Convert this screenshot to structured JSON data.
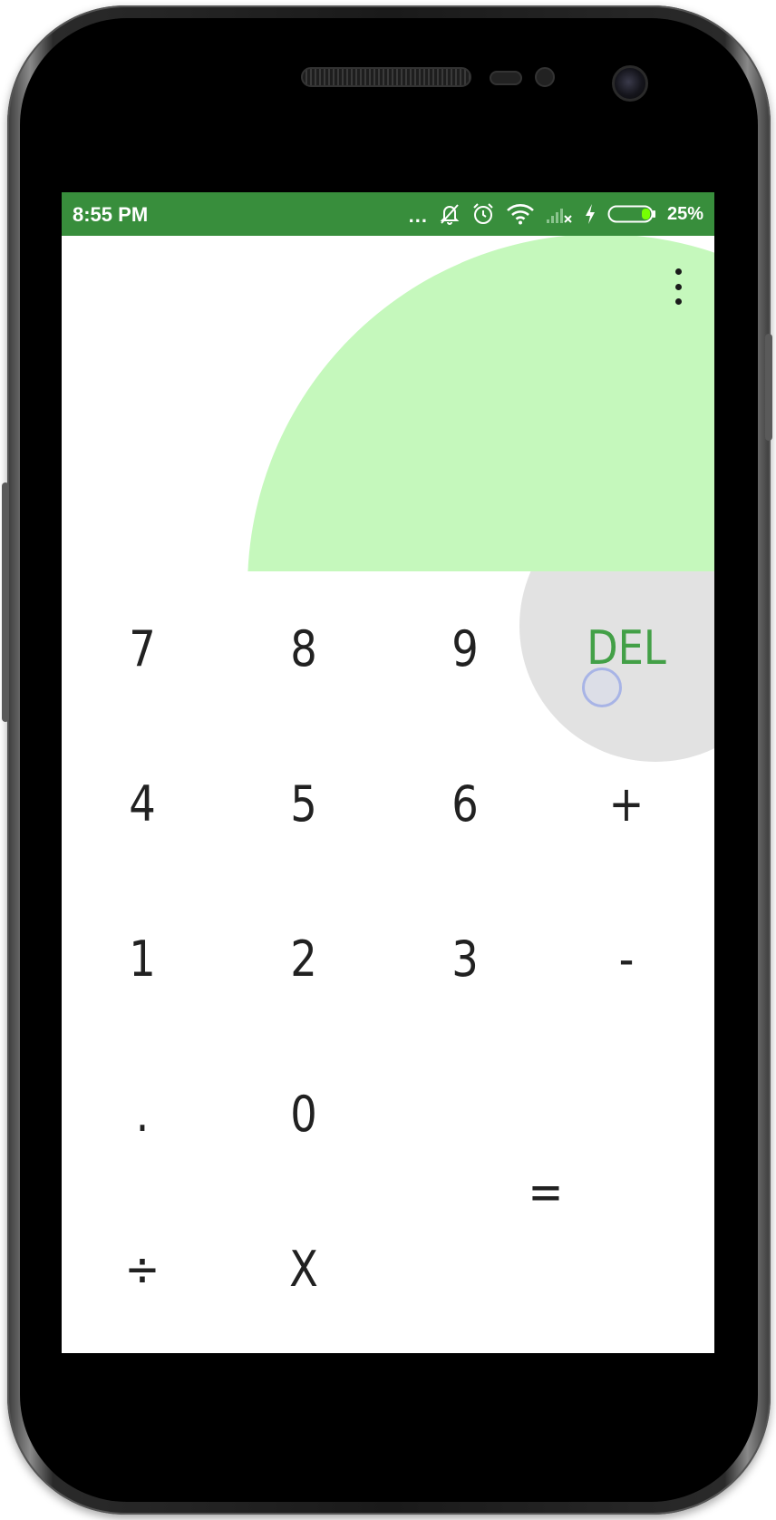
{
  "status_bar": {
    "time": "8:55 PM",
    "more_indicator": "...",
    "battery_percent": "25%",
    "icons": [
      "notifications-off-icon",
      "alarm-icon",
      "wifi-icon",
      "signal-no-sim-icon",
      "charging-bolt-icon",
      "battery-icon"
    ]
  },
  "display": {
    "expression": "",
    "result": "",
    "reveal_color": "#c5f8bc",
    "menu_icon": "more-vert-icon"
  },
  "keypad": {
    "rows": [
      [
        "7",
        "8",
        "9",
        "DEL"
      ],
      [
        "4",
        "5",
        "6",
        "+"
      ],
      [
        "1",
        "2",
        "3",
        "-"
      ],
      [
        ".",
        "0",
        "",
        "="
      ],
      [
        "÷",
        "X",
        "",
        ""
      ]
    ],
    "keys": {
      "k7": "7",
      "k8": "8",
      "k9": "9",
      "del": "DEL",
      "k4": "4",
      "k5": "5",
      "k6": "6",
      "plus": "+",
      "k1": "1",
      "k2": "2",
      "k3": "3",
      "minus": "-",
      "dot": ".",
      "k0": "0",
      "equals": "=",
      "divide": "÷",
      "multiply": "X"
    }
  },
  "colors": {
    "status_bar": "#388e3c",
    "accent": "#43a047",
    "reveal": "#c5f8bc",
    "ripple": "#e2e2e2",
    "digit_text": "#212121"
  }
}
